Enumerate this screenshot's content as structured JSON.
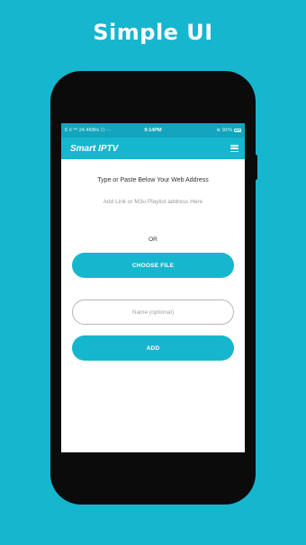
{
  "banner": {
    "headline": "Simple UI"
  },
  "statusbar": {
    "left": "Ɛ ıl ⁴ᴳ 24.4KB/s ☐ ···",
    "time": "9:14PM",
    "battery": "91%"
  },
  "appbar": {
    "title": "Smart IPTV",
    "menu_icon": "hamburger-menu-icon"
  },
  "form": {
    "instruction": "Type or Paste Below Your Web Address",
    "link_placeholder": "Add Link or M3u Playlist address Here",
    "or_label": "OR",
    "choose_file_label": "CHOOSE FILE",
    "name_placeholder": "Name (optional)",
    "add_label": "ADD"
  },
  "colors": {
    "accent": "#16b6cf",
    "statusbar": "#13a5bd",
    "phone": "#0b0b0b"
  }
}
